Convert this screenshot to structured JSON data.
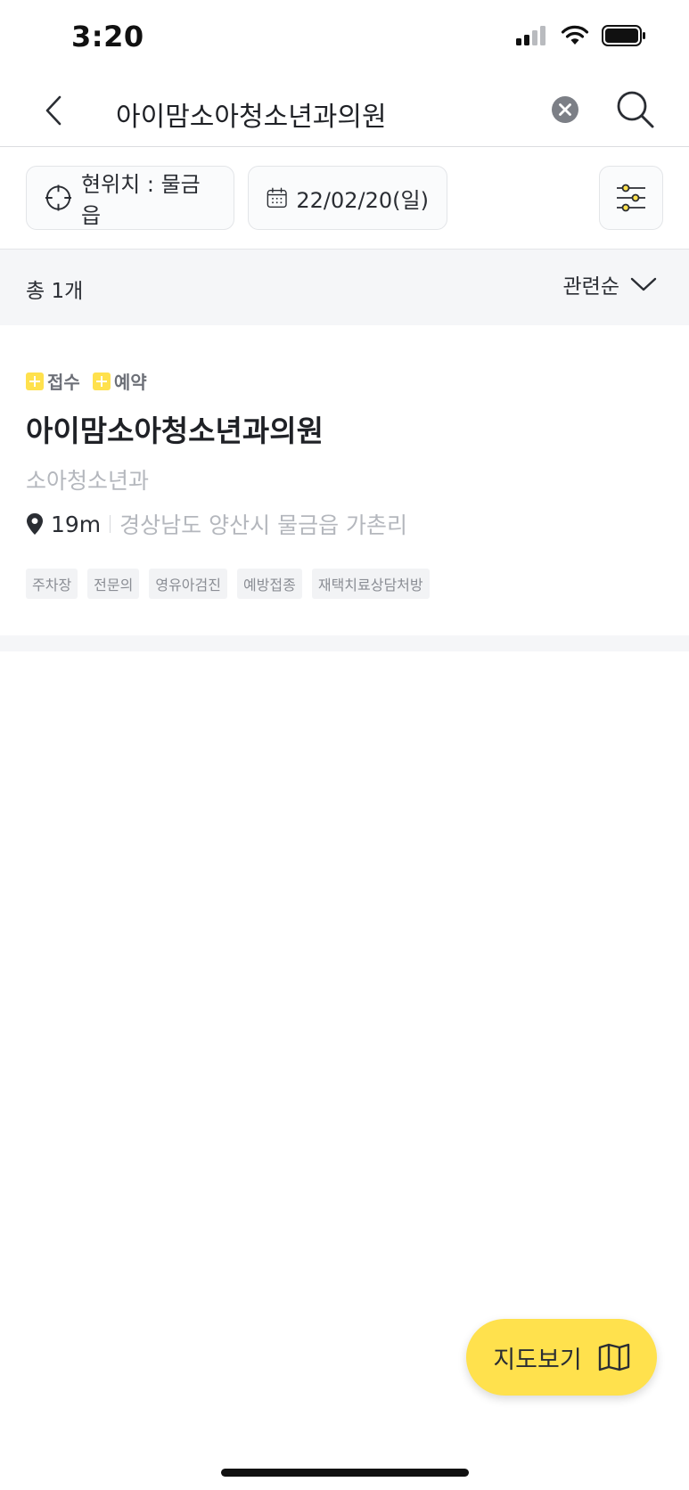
{
  "status_bar": {
    "time": "3:20"
  },
  "header": {
    "search_query": "아이맘소아청소년과의원"
  },
  "filters": {
    "location": "현위치 : 물금읍",
    "date": "22/02/20(일)"
  },
  "results": {
    "count_label": "총 1개",
    "sort_label": "관련순"
  },
  "hospital": {
    "badges": [
      "접수",
      "예약"
    ],
    "name": "아이맘소아청소년과의원",
    "department": "소아청소년과",
    "distance": "19m",
    "address": "경상남도 양산시 물금읍 가촌리",
    "tags": [
      "주차장",
      "전문의",
      "영유아검진",
      "예방접종",
      "재택치료상담처방"
    ]
  },
  "map_button": {
    "label": "지도보기"
  },
  "colors": {
    "accent": "#ffe14d",
    "text_primary": "#1f2126",
    "text_muted": "#b4b7bd"
  }
}
